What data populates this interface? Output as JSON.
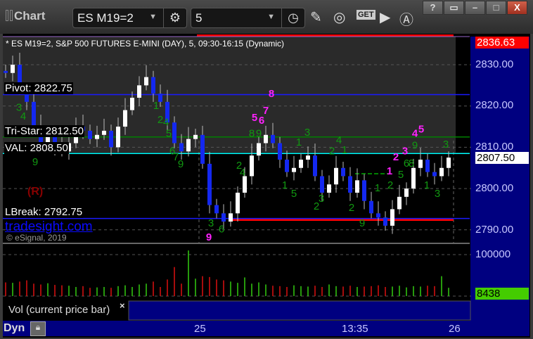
{
  "window": {
    "title": "Chart",
    "symbol": "ES M19=2",
    "interval": "5",
    "buttons": [
      "help",
      "restore",
      "minimize",
      "maximize",
      "close"
    ],
    "help": "?",
    "close": "X"
  },
  "toolbar": {
    "get_label": "GET",
    "icons": [
      "gear-icon",
      "clock-icon",
      "pencil-icon",
      "study-icon",
      "get-icon",
      "play-icon",
      "alert-icon"
    ]
  },
  "header": "* ES M19=2, S&P 500 FUTURES E-MINI (DAY), 5, 09:30-16:15 (Dynamic)",
  "levels": {
    "pivot": "Pivot: 2822.75",
    "tristar": "Tri-Star: 2812.50",
    "val": "VAL: 2808.50",
    "lbreak": "LBreak: 2792.75",
    "r": "(R)"
  },
  "watermark": {
    "site": "tradesight.com",
    "copyright": "© eSignal, 2019"
  },
  "price_axis": {
    "ticks": [
      "2830.00",
      "2820.00",
      "2810.00",
      "2800.00",
      "2790.00"
    ],
    "high_tag": "2836.63",
    "last_tag": "2807.50"
  },
  "volume_axis": {
    "tick": "100000",
    "last_tag": "8438"
  },
  "vol_legend": {
    "label": "Vol (current price bar)",
    "close": "×"
  },
  "time_axis": {
    "labels": [
      "25",
      "13:35",
      "26"
    ],
    "dyn": "Dyn"
  },
  "colors": {
    "up": "#ffffff",
    "down": "#1428f0",
    "pivot": "#1a1aff",
    "tristar": "#008000",
    "val": "#00ffff",
    "lbreak": "#1a1aff",
    "vol_up": "#33cc11",
    "vol_down": "#dd1111",
    "axis_bg": "#000080"
  },
  "chart_data": {
    "type": "candlestick",
    "ylim": [
      2785,
      2837
    ],
    "closes": [
      2828,
      2830,
      2824,
      2821,
      2815,
      2811,
      2813,
      2810,
      2809,
      2811,
      2815,
      2814,
      2812,
      2813,
      2814,
      2810,
      2815,
      2819,
      2822,
      2825,
      2827,
      2823,
      2821,
      2816,
      2811,
      2809,
      2812,
      2813,
      2806,
      2796,
      2794,
      2792,
      2794,
      2799,
      2803,
      2808,
      2811,
      2813,
      2811,
      2807,
      2804,
      2805,
      2807,
      2808,
      2803,
      2799,
      2801,
      2805,
      2803,
      2799,
      2802,
      2797,
      2794,
      2793,
      2791,
      2795,
      2798,
      2800,
      2805,
      2807,
      2804,
      2803,
      2805,
      2807.5
    ],
    "volume": [
      33000,
      32000,
      35000,
      38000,
      30000,
      28000,
      31000,
      27000,
      26000,
      25000,
      22000,
      24000,
      20000,
      21000,
      22000,
      20000,
      24000,
      26000,
      22000,
      28000,
      30000,
      35000,
      22000,
      40000,
      70000,
      30000,
      110000,
      42000,
      48000,
      46000,
      40000,
      38000,
      35000,
      32000,
      45000,
      30000,
      33000,
      28000,
      25000,
      24000,
      22000,
      26000,
      24000,
      23000,
      25000,
      22000,
      28000,
      24000,
      23000,
      25000,
      22000,
      23000,
      24000,
      26000,
      22000,
      23000,
      25000,
      21000,
      24000,
      23000,
      25000,
      24000,
      48000,
      20000
    ],
    "lines": [
      {
        "name": "Pivot",
        "value": 2822.75
      },
      {
        "name": "Tri-Star",
        "value": 2812.5
      },
      {
        "name": "VAL",
        "value": 2808.5
      },
      {
        "name": "LBreak",
        "value": 2792.75
      }
    ],
    "annotations": [
      {
        "t": "3",
        "bar": 1.9,
        "p": 2818.8,
        "c": "g"
      },
      {
        "t": "4",
        "bar": 2.5,
        "p": 2816.7,
        "c": "g"
      },
      {
        "t": "9",
        "bar": 4.2,
        "p": 2805.6,
        "c": "g"
      },
      {
        "t": "1",
        "bar": 21.4,
        "p": 2819.3,
        "c": "g"
      },
      {
        "t": "2",
        "bar": 22,
        "p": 2815.9,
        "c": "g"
      },
      {
        "t": "4",
        "bar": 22.8,
        "p": 2815.3,
        "c": "g"
      },
      {
        "t": "5",
        "bar": 23.2,
        "p": 2812.5,
        "c": "g"
      },
      {
        "t": "6",
        "bar": 23.7,
        "p": 2808.3,
        "c": "g"
      },
      {
        "t": "7",
        "bar": 24.2,
        "p": 2806.8,
        "c": "g"
      },
      {
        "t": "9",
        "bar": 24.9,
        "p": 2805.1,
        "c": "g"
      },
      {
        "t": "3",
        "bar": 29.2,
        "p": 2790.8,
        "c": "g"
      },
      {
        "t": "6",
        "bar": 30.7,
        "p": 2789.4,
        "c": "g"
      },
      {
        "t": "2",
        "bar": 33.2,
        "p": 2804.8,
        "c": "g"
      },
      {
        "t": "4",
        "bar": 33.7,
        "p": 2803.1,
        "c": "g"
      },
      {
        "t": "8",
        "bar": 35,
        "p": 2812.5,
        "c": "g"
      },
      {
        "t": "9",
        "bar": 36,
        "p": 2812.5,
        "c": "g"
      },
      {
        "t": "1",
        "bar": 39.7,
        "p": 2800.0,
        "c": "g"
      },
      {
        "t": "5",
        "bar": 41,
        "p": 2798.0,
        "c": "g"
      },
      {
        "t": "1",
        "bar": 41.7,
        "p": 2810.4,
        "c": "g"
      },
      {
        "t": "3",
        "bar": 42.9,
        "p": 2812.8,
        "c": "g"
      },
      {
        "t": "2",
        "bar": 44.2,
        "p": 2794.9,
        "c": "g"
      },
      {
        "t": "3",
        "bar": 44.9,
        "p": 2796.8,
        "c": "g"
      },
      {
        "t": "2",
        "bar": 46.4,
        "p": 2808.3,
        "c": "g"
      },
      {
        "t": "4",
        "bar": 47.4,
        "p": 2810.9,
        "c": "g"
      },
      {
        "t": "1",
        "bar": 48.2,
        "p": 2808.5,
        "c": "g"
      },
      {
        "t": "2",
        "bar": 49.2,
        "p": 2794.6,
        "c": "g"
      },
      {
        "t": "9",
        "bar": 50.7,
        "p": 2790.8,
        "c": "g"
      },
      {
        "t": "1",
        "bar": 52.9,
        "p": 2799.3,
        "c": "g"
      },
      {
        "t": "2",
        "bar": 54.7,
        "p": 2800.0,
        "c": "g"
      },
      {
        "t": "5",
        "bar": 56.2,
        "p": 2802.6,
        "c": "g"
      },
      {
        "t": "6",
        "bar": 57,
        "p": 2805.3,
        "c": "g"
      },
      {
        "t": "8",
        "bar": 57.7,
        "p": 2805.3,
        "c": "g"
      },
      {
        "t": "9",
        "bar": 58.2,
        "p": 2809.6,
        "c": "g"
      },
      {
        "t": "1",
        "bar": 59.9,
        "p": 2800.0,
        "c": "g"
      },
      {
        "t": "3",
        "bar": 61.4,
        "p": 2798.0,
        "c": "g"
      },
      {
        "t": "3",
        "bar": 62.6,
        "p": 2809.9,
        "c": "g"
      },
      {
        "t": "5",
        "bar": 35.4,
        "p": 2816.4,
        "c": "m"
      },
      {
        "t": "6",
        "bar": 36.4,
        "p": 2815.7,
        "c": "m"
      },
      {
        "t": "7",
        "bar": 37,
        "p": 2818.1,
        "c": "m"
      },
      {
        "t": "8",
        "bar": 37.8,
        "p": 2822.2,
        "c": "m"
      },
      {
        "t": "9",
        "bar": 28.9,
        "p": 2787.4,
        "c": "m"
      },
      {
        "t": "1",
        "bar": 54.6,
        "p": 2803.4,
        "c": "m"
      },
      {
        "t": "2",
        "bar": 55.5,
        "p": 2806.8,
        "c": "m"
      },
      {
        "t": "3",
        "bar": 56.8,
        "p": 2808.3,
        "c": "m"
      },
      {
        "t": "4",
        "bar": 58.2,
        "p": 2812.5,
        "c": "m"
      },
      {
        "t": "5",
        "bar": 59.1,
        "p": 2813.6,
        "c": "m"
      }
    ]
  }
}
